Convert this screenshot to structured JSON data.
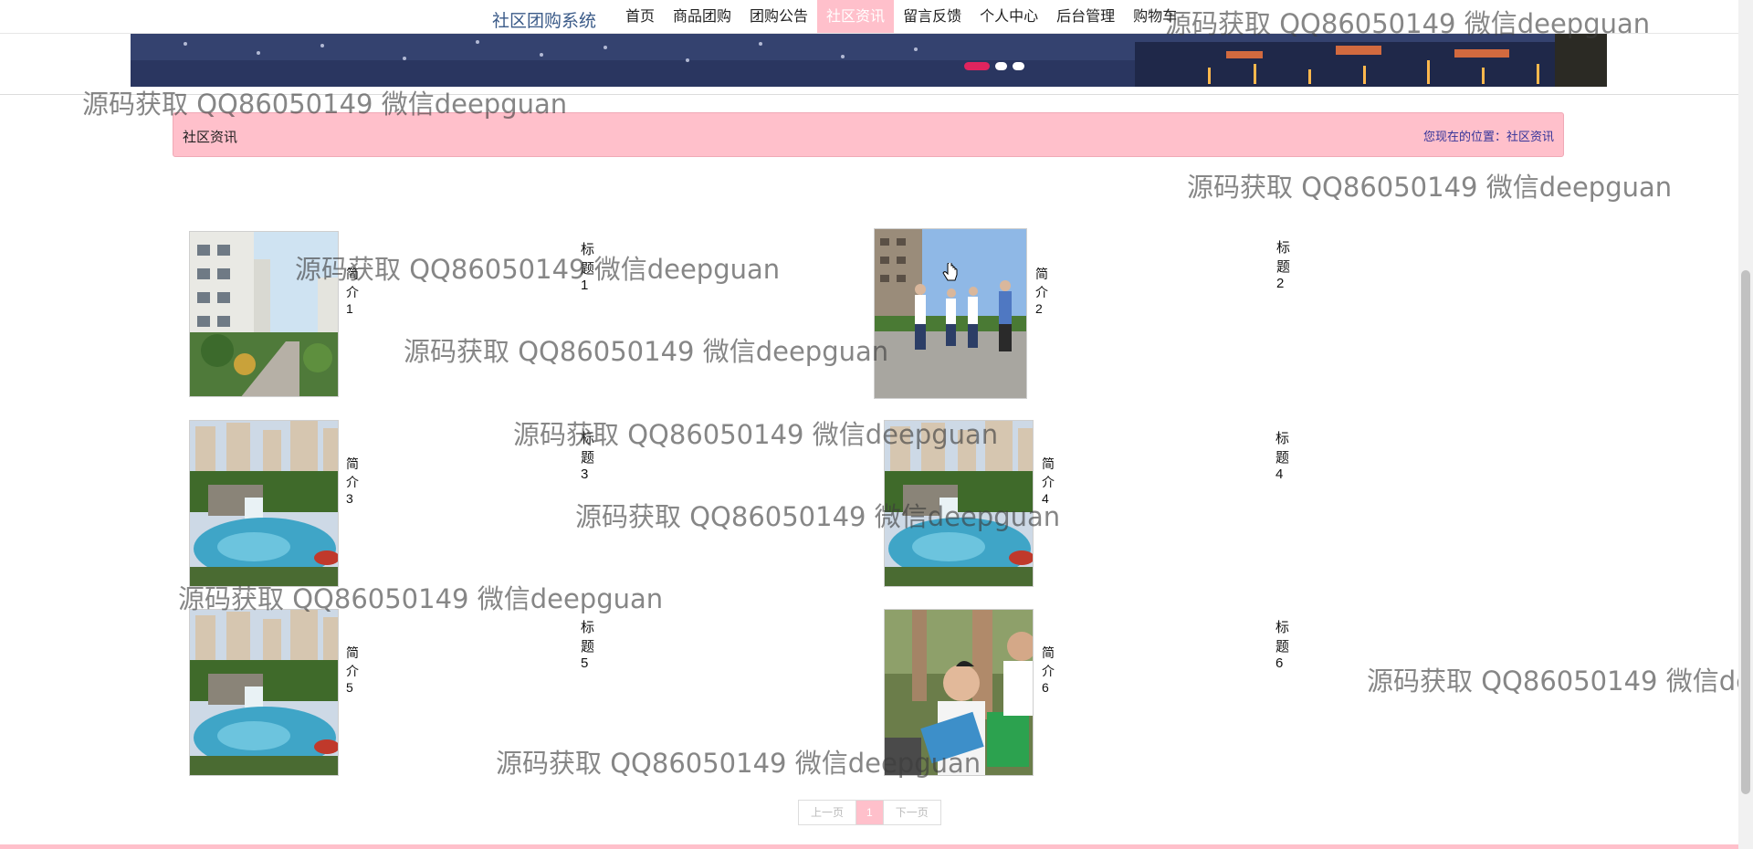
{
  "nav": {
    "brand": "社区团购系统",
    "items": [
      {
        "label": "首页",
        "active": false
      },
      {
        "label": "商品团购",
        "active": false
      },
      {
        "label": "团购公告",
        "active": false
      },
      {
        "label": "社区资讯",
        "active": true
      },
      {
        "label": "留言反馈",
        "active": false
      },
      {
        "label": "个人中心",
        "active": false
      },
      {
        "label": "后台管理",
        "active": false
      },
      {
        "label": "购物车",
        "active": false
      }
    ]
  },
  "banner": {
    "active_slide": 1,
    "slide_count": 3
  },
  "breadcrumb": {
    "title": "社区资讯",
    "location_prefix": "您现在的位置：",
    "location": "社区资讯"
  },
  "news": [
    {
      "title": "标题1",
      "intro": "简介1"
    },
    {
      "title": "标题2",
      "intro": "简介2"
    },
    {
      "title": "标题3",
      "intro": "简介3"
    },
    {
      "title": "标题4",
      "intro": "简介4"
    },
    {
      "title": "标题5",
      "intro": "简介5"
    },
    {
      "title": "标题6",
      "intro": "简介6"
    }
  ],
  "pager": {
    "prev": "上一页",
    "current": "1",
    "next": "下一页"
  },
  "watermark": "源码获取 QQ86050149 微信deepguan",
  "colors": {
    "accent": "#ffc0cb",
    "brand": "#3a5a88",
    "location_link": "#333399"
  }
}
